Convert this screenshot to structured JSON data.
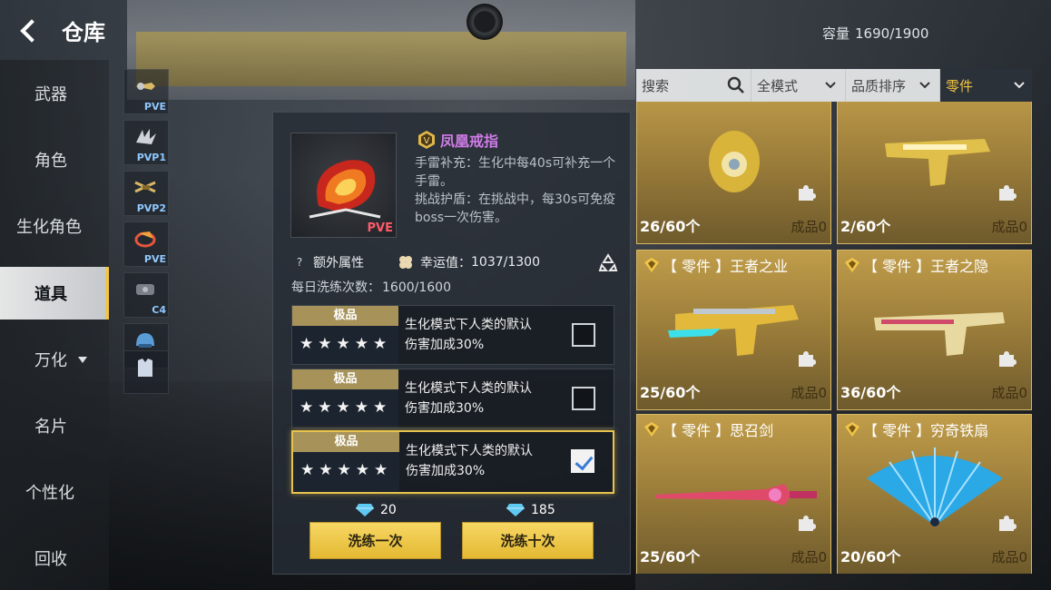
{
  "header": {
    "title": "仓库",
    "capacity_label": "容量",
    "capacity_value": "1690/1900"
  },
  "nav": [
    {
      "label": "武器"
    },
    {
      "label": "角色"
    },
    {
      "label": "生化角色"
    },
    {
      "label": "道具",
      "active": true
    },
    {
      "label": "万化"
    },
    {
      "label": "名片"
    },
    {
      "label": "个性化"
    },
    {
      "label": "回收"
    }
  ],
  "equip_slots": [
    {
      "tag": "PVE",
      "icon": "grenade-icon"
    },
    {
      "tag": "PVP1",
      "icon": "claw-icon"
    },
    {
      "tag": "PVP2",
      "icon": "crossbow-icon"
    },
    {
      "tag": "PVE",
      "icon": "ring-icon"
    },
    {
      "tag": "C4",
      "icon": "c4-icon"
    },
    {
      "tag": "",
      "icon": "helmet-icon"
    },
    {
      "tag": "",
      "icon": "armor-icon"
    }
  ],
  "detail": {
    "thumb_tag": "PVE",
    "name": "凤凰戒指",
    "tier": "V",
    "desc1": "手雷补充：生化中每40s可补充一个手雷。",
    "desc2": "挑战护盾：在挑战中，每30s可免疫boss一次伤害。",
    "extra_attr": "额外属性",
    "luck_label": "幸运值：",
    "luck_value": "1037/1300",
    "daily_label": "每日洗练次数：",
    "daily_value": "1600/1600",
    "attrs": [
      {
        "grade": "极品",
        "stars": "★★★★★",
        "line1": "生化模式下人类的默认",
        "line2": "伤害加成30%",
        "checked": false
      },
      {
        "grade": "极品",
        "stars": "★★★★★",
        "line1": "生化模式下人类的默认",
        "line2": "伤害加成30%",
        "checked": false
      },
      {
        "grade": "极品",
        "stars": "★★★★★",
        "line1": "生化模式下人类的默认",
        "line2": "伤害加成30%",
        "checked": true
      }
    ],
    "cost_once": "20",
    "cost_ten": "185",
    "btn_once": "洗练一次",
    "btn_ten": "洗练十次"
  },
  "filters": {
    "search_placeholder": "搜索",
    "mode": "全模式",
    "sort": "品质排序",
    "category": "零件"
  },
  "cards": [
    {
      "title": "",
      "count": "26/60个",
      "product": "成品0",
      "art": "grenade"
    },
    {
      "title": "",
      "count": "2/60个",
      "product": "成品0",
      "art": "pistol-gold"
    },
    {
      "title": "【 零件 】王者之业",
      "count": "25/60个",
      "product": "成品0",
      "art": "pistol-cyan"
    },
    {
      "title": "【 零件 】王者之隐",
      "count": "36/60个",
      "product": "成品0",
      "art": "pistol-long"
    },
    {
      "title": "【 零件 】思召剑",
      "count": "25/60个",
      "product": "成品0",
      "art": "sword"
    },
    {
      "title": "【 零件 】穷奇铁扇",
      "count": "20/60个",
      "product": "成品0",
      "art": "fan"
    }
  ],
  "colors": {
    "accent": "#e7c34e",
    "card_gold": "#c09d4a",
    "tier_purple": "#d07ce8"
  }
}
